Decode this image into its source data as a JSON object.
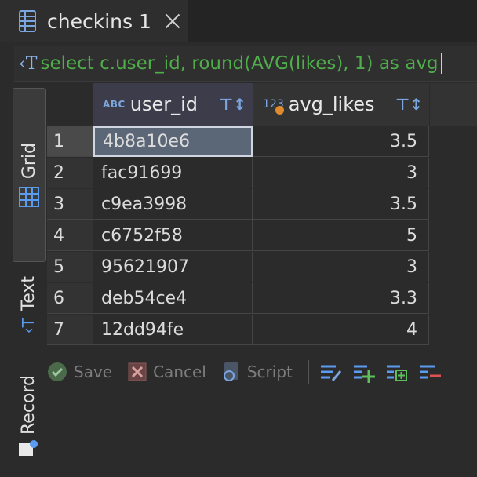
{
  "tab": {
    "title": "checkins 1"
  },
  "sql": {
    "text": "select c.user_id, round(AVG(likes), 1) as avg"
  },
  "sidebar": {
    "grid": "Grid",
    "text": "Text",
    "record": "Record"
  },
  "columns": [
    {
      "type": "ABC",
      "name": "user_id"
    },
    {
      "type": "123",
      "name": "avg_likes"
    }
  ],
  "rows": [
    {
      "n": "1",
      "user_id": "4b8a10e6",
      "avg_likes": "3.5"
    },
    {
      "n": "2",
      "user_id": "fac91699",
      "avg_likes": "3"
    },
    {
      "n": "3",
      "user_id": "c9ea3998",
      "avg_likes": "3.5"
    },
    {
      "n": "4",
      "user_id": "c6752f58",
      "avg_likes": "5"
    },
    {
      "n": "5",
      "user_id": "95621907",
      "avg_likes": "3"
    },
    {
      "n": "6",
      "user_id": "deb54ce4",
      "avg_likes": "3.3"
    },
    {
      "n": "7",
      "user_id": "12dd94fe",
      "avg_likes": "4"
    }
  ],
  "toolbar": {
    "save": "Save",
    "cancel": "Cancel",
    "script": "Script"
  }
}
